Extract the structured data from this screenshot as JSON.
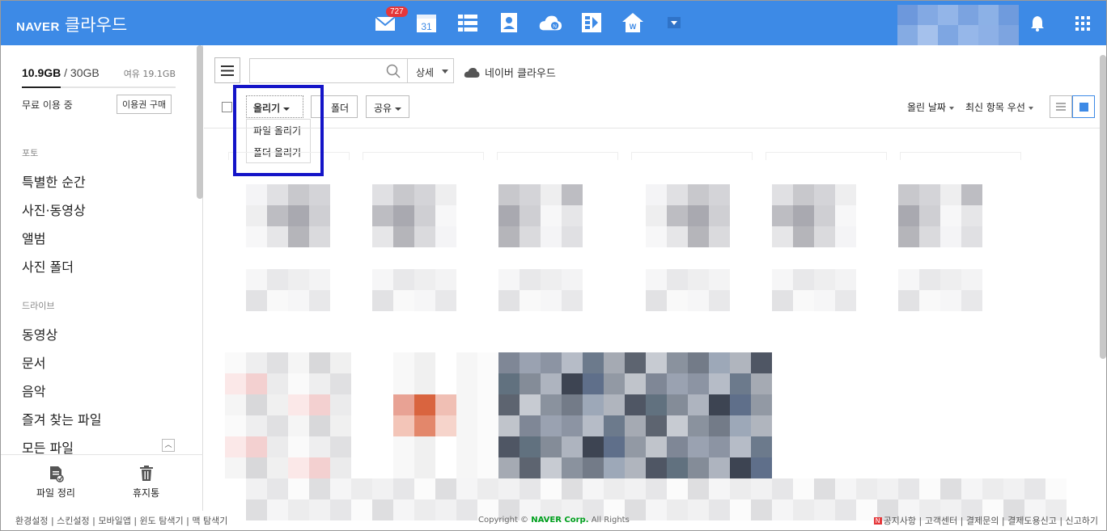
{
  "header": {
    "logo_brand": "NAVER",
    "logo_service": "클라우드",
    "mail_badge": "727",
    "calendar_day": "31",
    "accent": "#3d8ae6"
  },
  "sidebar": {
    "storage_used": "10.9GB",
    "storage_sep": " / ",
    "storage_total": "30GB",
    "storage_free": "여유 19.1GB",
    "storage_fraction": 0.363,
    "plan_label": "무료 이용 중",
    "buy_label": "이용권 구매",
    "sections": [
      {
        "title": "포토",
        "items": [
          "특별한 순간",
          "사진·동영상",
          "앨범",
          "사진 폴더"
        ]
      },
      {
        "title": "드라이브",
        "items": [
          "동영상",
          "문서",
          "음악",
          "즐겨 찾는 파일",
          "모든 파일"
        ]
      }
    ],
    "bottom": [
      {
        "label": "파일 정리",
        "icon": "file-clean-icon"
      },
      {
        "label": "휴지통",
        "icon": "trash-icon"
      }
    ]
  },
  "toolbar": {
    "search_placeholder": "",
    "detail_label": "상세",
    "cloud_label": "네이버 클라우드",
    "upload_label": "올리기",
    "folder_label": "폴더",
    "share_label": "공유",
    "upload_menu": [
      "파일 올리기",
      "폴더 올리기"
    ],
    "sort_date": "올린 날짜",
    "sort_order": "최신 항목 우선"
  },
  "footer": {
    "left": "환경설정 | 스킨설정 | 모바일앱 | 윈도 탐색기 | 맥 탐색기",
    "copyright_prefix": "Copyright © ",
    "copyright_brand": "NAVER Corp.",
    "copyright_suffix": " All Rights",
    "right_badge": "N",
    "right": "공지사항 | 고객센터 | 결제문의 | 결제도용신고 | 신고하기"
  }
}
